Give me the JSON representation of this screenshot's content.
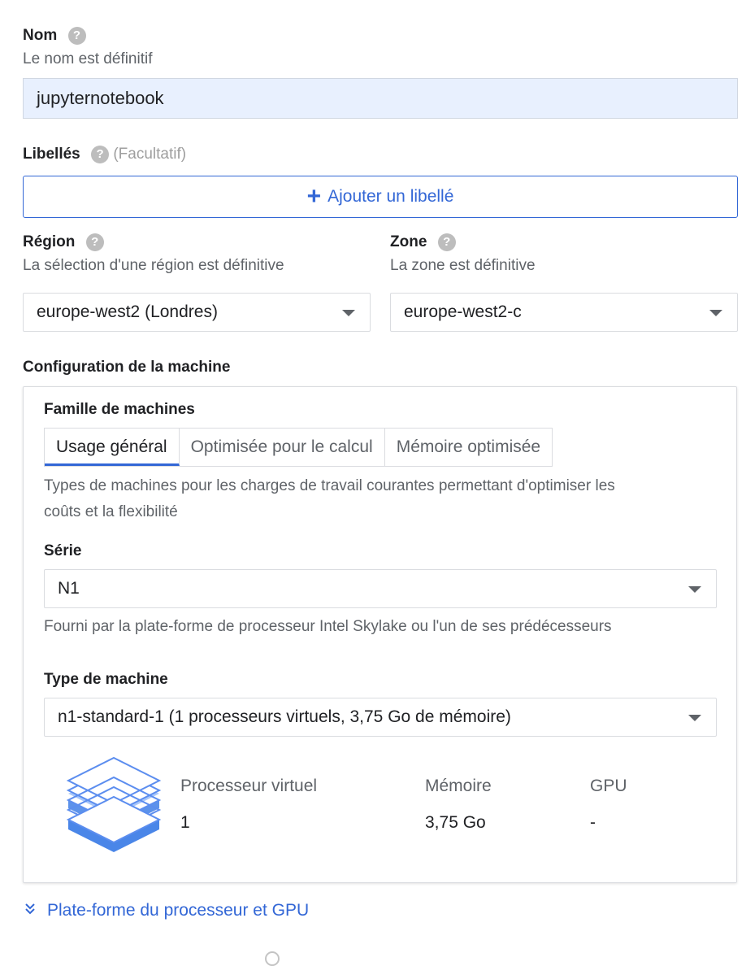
{
  "name": {
    "label": "Nom",
    "hint": "Le nom est définitif",
    "value": "jupyternotebook"
  },
  "labels": {
    "label": "Libellés",
    "optional": "(Facultatif)",
    "add_button": "Ajouter un libellé"
  },
  "region": {
    "label": "Région",
    "hint": "La sélection d'une région est définitive",
    "value": "europe-west2 (Londres)"
  },
  "zone": {
    "label": "Zone",
    "hint": "La zone est définitive",
    "value": "europe-west2-c"
  },
  "machine_config": {
    "title": "Configuration de la machine",
    "family_label": "Famille de machines",
    "tabs": [
      "Usage général",
      "Optimisée pour le calcul",
      "Mémoire optimisée"
    ],
    "active_tab": 0,
    "family_desc_line1": "Types de machines pour les charges de travail courantes permettant d'optimiser les",
    "family_desc_line2": "coûts et la flexibilité",
    "series_label": "Série",
    "series_value": "N1",
    "series_desc": "Fourni par la plate-forme de processeur Intel Skylake ou l'un de ses prédécesseurs",
    "type_label": "Type de machine",
    "type_value": "n1-standard-1 (1 processeurs virtuels, 3,75 Go de mémoire)",
    "stats": [
      {
        "header": "Processeur virtuel",
        "value": "1"
      },
      {
        "header": "Mémoire",
        "value": "3,75 Go"
      },
      {
        "header": "GPU",
        "value": "-"
      }
    ]
  },
  "expand_link": "Plate-forme du processeur et GPU",
  "colors": {
    "accent": "#3367d6",
    "input_fill": "#e8f0fe"
  }
}
